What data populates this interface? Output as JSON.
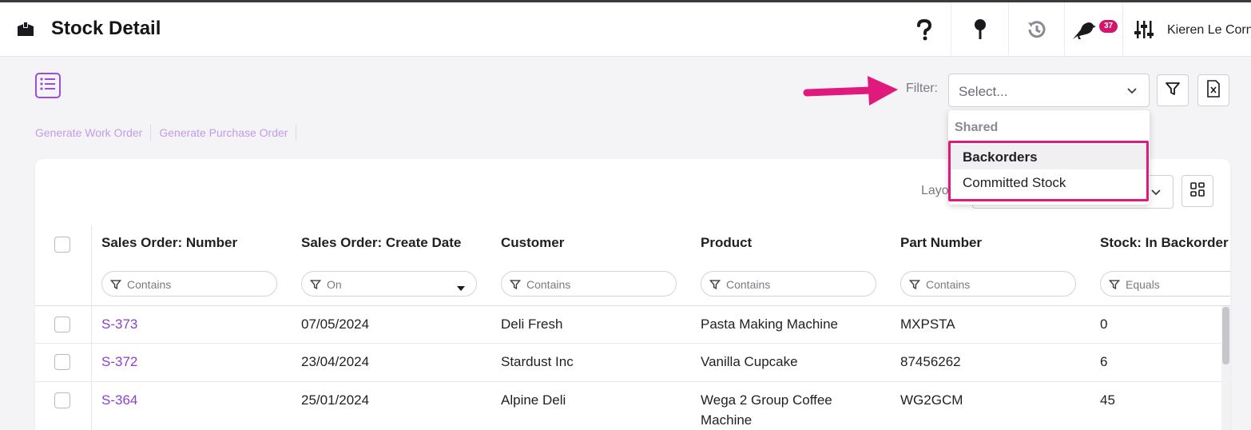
{
  "header": {
    "title": "Stock Detail",
    "notification_count": "37",
    "user_name": "Kieren Le Corn",
    "icons": [
      "box-icon",
      "help-icon",
      "pin-icon",
      "history-icon",
      "bird-icon",
      "sliders-icon"
    ]
  },
  "toolbar": {
    "generate_work_order": "Generate Work Order",
    "generate_purchase_order": "Generate Purchase Order",
    "filter_label": "Filter:",
    "filter_placeholder": "Select...",
    "layout_label": "Layo"
  },
  "filter_dropdown": {
    "group_label": "Shared",
    "options": [
      "Backorders",
      "Committed Stock"
    ],
    "highlighted": "Backorders"
  },
  "table": {
    "columns": [
      {
        "label": "Sales Order: Number",
        "filter": "Contains",
        "filter_type": "text"
      },
      {
        "label": "Sales Order: Create Date",
        "filter": "On",
        "filter_type": "select"
      },
      {
        "label": "Customer",
        "filter": "Contains",
        "filter_type": "text"
      },
      {
        "label": "Product",
        "filter": "Contains",
        "filter_type": "text"
      },
      {
        "label": "Part Number",
        "filter": "Contains",
        "filter_type": "text"
      },
      {
        "label": "Stock: In Backorder",
        "filter": "Equals",
        "filter_type": "text"
      }
    ],
    "rows": [
      {
        "number": "S-373",
        "date": "07/05/2024",
        "customer": "Deli Fresh",
        "product": "Pasta Making Machine",
        "product_line2": "",
        "part": "MXPSTA",
        "backorder": "0"
      },
      {
        "number": "S-372",
        "date": "23/04/2024",
        "customer": "Stardust Inc",
        "product": "Vanilla Cupcake",
        "product_line2": "",
        "part": "87456262",
        "backorder": "6"
      },
      {
        "number": "S-364",
        "date": "25/01/2024",
        "customer": "Alpine Deli",
        "product": "Wega 2 Group Coffee",
        "product_line2": "Machine",
        "part": "WG2GCM",
        "backorder": "45"
      }
    ]
  },
  "colors": {
    "accent": "#8c3fd0",
    "highlight": "#e0197d",
    "badge": "#d4156b"
  }
}
